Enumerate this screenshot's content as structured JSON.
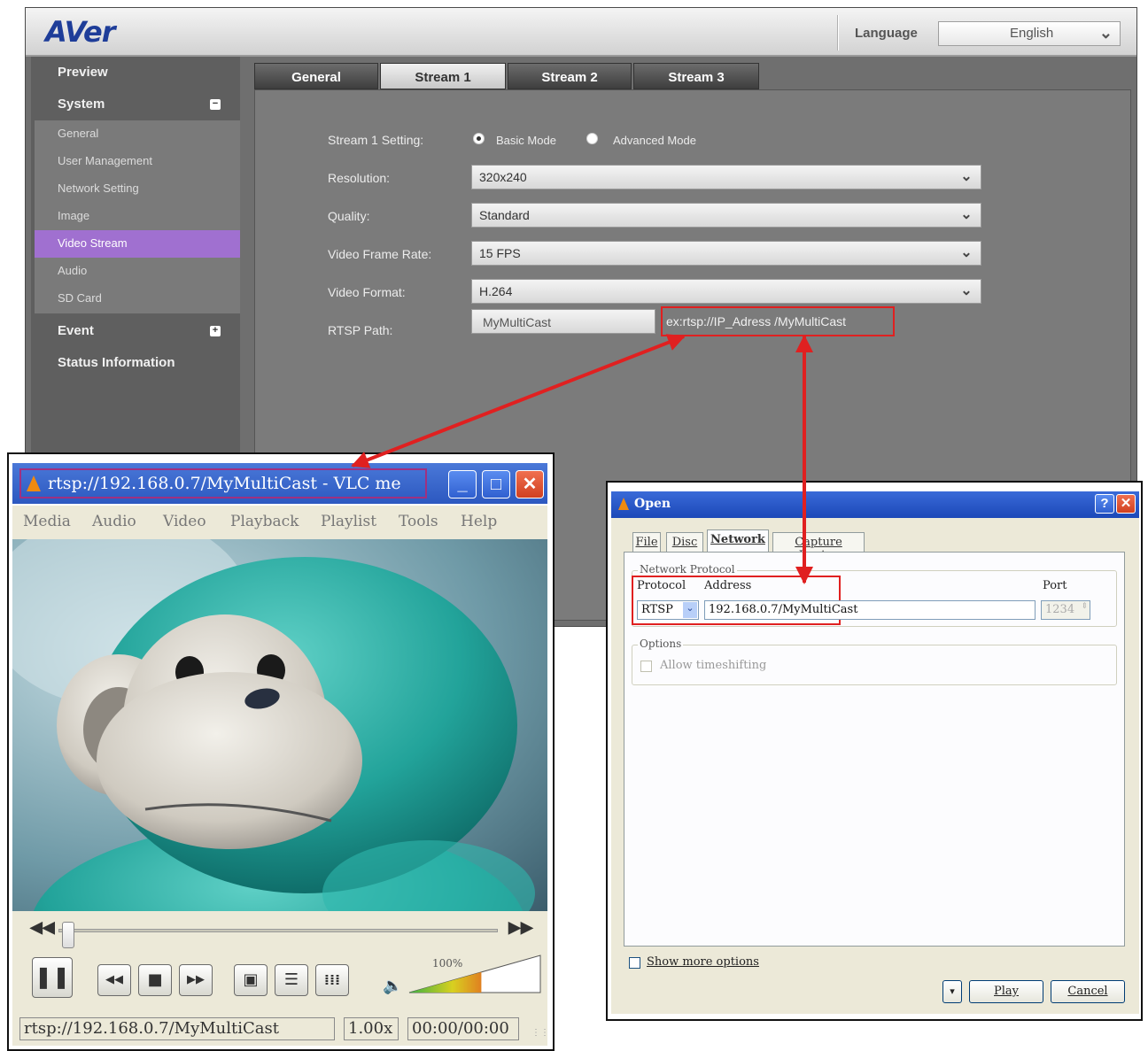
{
  "aver": {
    "logo": "AVer",
    "language_label": "Language",
    "language_value": "English",
    "sidebar": {
      "preview": "Preview",
      "system": "System",
      "system_items": [
        "General",
        "User Management",
        "Network Setting",
        "Image",
        "Video Stream",
        "Audio",
        "SD Card"
      ],
      "active_item": "Video Stream",
      "event": "Event",
      "status": "Status Information"
    },
    "tabs": [
      "General",
      "Stream 1",
      "Stream 2",
      "Stream 3"
    ],
    "active_tab": "Stream 1",
    "form": {
      "setting_label": "Stream 1 Setting:",
      "basic_mode": "Basic Mode",
      "advanced_mode": "Advanced Mode",
      "resolution_label": "Resolution:",
      "resolution_value": "320x240",
      "quality_label": "Quality:",
      "quality_value": "Standard",
      "frame_rate_label": "Video Frame Rate:",
      "frame_rate_value": "15 FPS",
      "format_label": "Video Format:",
      "format_value": "H.264",
      "rtsp_label": "RTSP Path:",
      "rtsp_value": "MyMultiCast",
      "rtsp_example": "ex:rtsp://IP_Adress /MyMultiCast"
    }
  },
  "vlc": {
    "title": "rtsp://192.168.0.7/MyMultiCast - VLC me",
    "menu": [
      "Media",
      "Audio",
      "Video",
      "Playback",
      "Playlist",
      "Tools",
      "Help"
    ],
    "volume": "100%",
    "volume_level": 0.55,
    "seek_position": 0.0,
    "status_path": "rtsp://192.168.0.7/MyMultiCast",
    "speed": "1.00x",
    "time": "00:00/00:00"
  },
  "open_dialog": {
    "title": "Open",
    "tabs": [
      "File",
      "Disc",
      "Network",
      "Capture Device"
    ],
    "active_tab": "Network",
    "group_protocol": "Network Protocol",
    "protocol_label": "Protocol",
    "address_label": "Address",
    "port_label": "Port",
    "protocol_value": "RTSP",
    "address_value": "192.168.0.7/MyMultiCast",
    "port_value": "1234",
    "group_options": "Options",
    "allow_timeshifting": "Allow timeshifting",
    "show_more_options": "Show more options",
    "play_button": "Play",
    "cancel_button": "Cancel"
  },
  "colors": {
    "aver_brand": "#1e3d99",
    "active_sidebar": "#a070d0",
    "annotation_red": "#e02020",
    "vlc_title_frame": "#a03080",
    "xp_titlebar": "#2c58c0"
  }
}
